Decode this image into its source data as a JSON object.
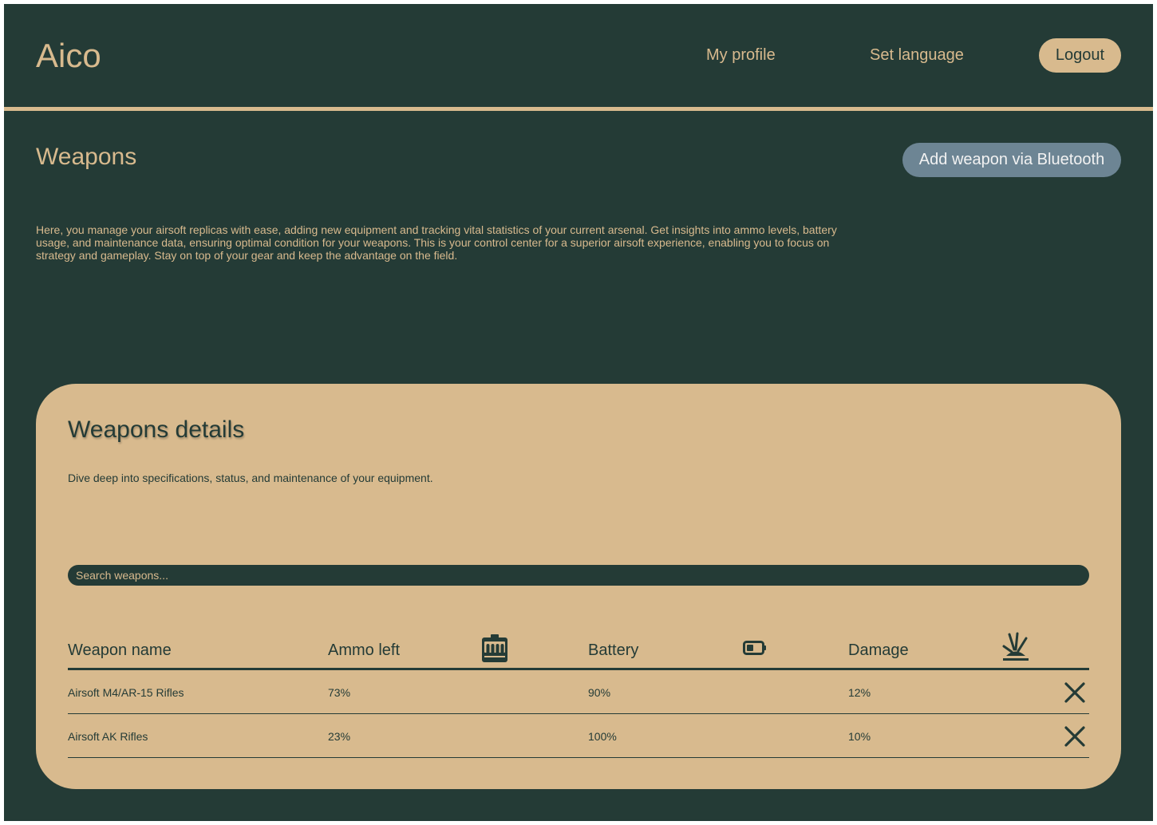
{
  "header": {
    "brand": "Aico",
    "nav": {
      "profile": "My profile",
      "language": "Set language",
      "logout": "Logout"
    }
  },
  "intro": {
    "title": "Weapons",
    "add_button": "Add weapon via Bluetooth",
    "description": "Here, you manage your airsoft replicas with ease, adding new equipment and tracking vital statistics of your current arsenal. Get insights into ammo levels, battery usage, and maintenance data, ensuring optimal condition for your weapons. This is your control center for a superior airsoft experience, enabling you to focus on strategy and gameplay. Stay on top of your gear and keep the advantage on the field."
  },
  "details": {
    "title": "Weapons details",
    "subtitle": "Dive deep into specifications, status, and maintenance of your equipment.",
    "search_placeholder": "Search weapons...",
    "columns": {
      "name": "Weapon name",
      "ammo": "Ammo left",
      "battery": "Battery",
      "damage": "Damage"
    },
    "column_icons": {
      "ammo": "ammo-box-icon",
      "battery": "battery-icon",
      "damage": "explosion-icon"
    },
    "rows": [
      {
        "name": "Airsoft M4/AR-15 Rifles",
        "ammo": "73%",
        "battery": "90%",
        "damage": "12%"
      },
      {
        "name": "Airsoft AK Rifles",
        "ammo": "23%",
        "battery": "100%",
        "damage": "10%"
      }
    ],
    "row_action_icon": "close-icon"
  },
  "colors": {
    "background": "#243b36",
    "accent": "#d8ba8e",
    "button_secondary": "#6d8594"
  }
}
